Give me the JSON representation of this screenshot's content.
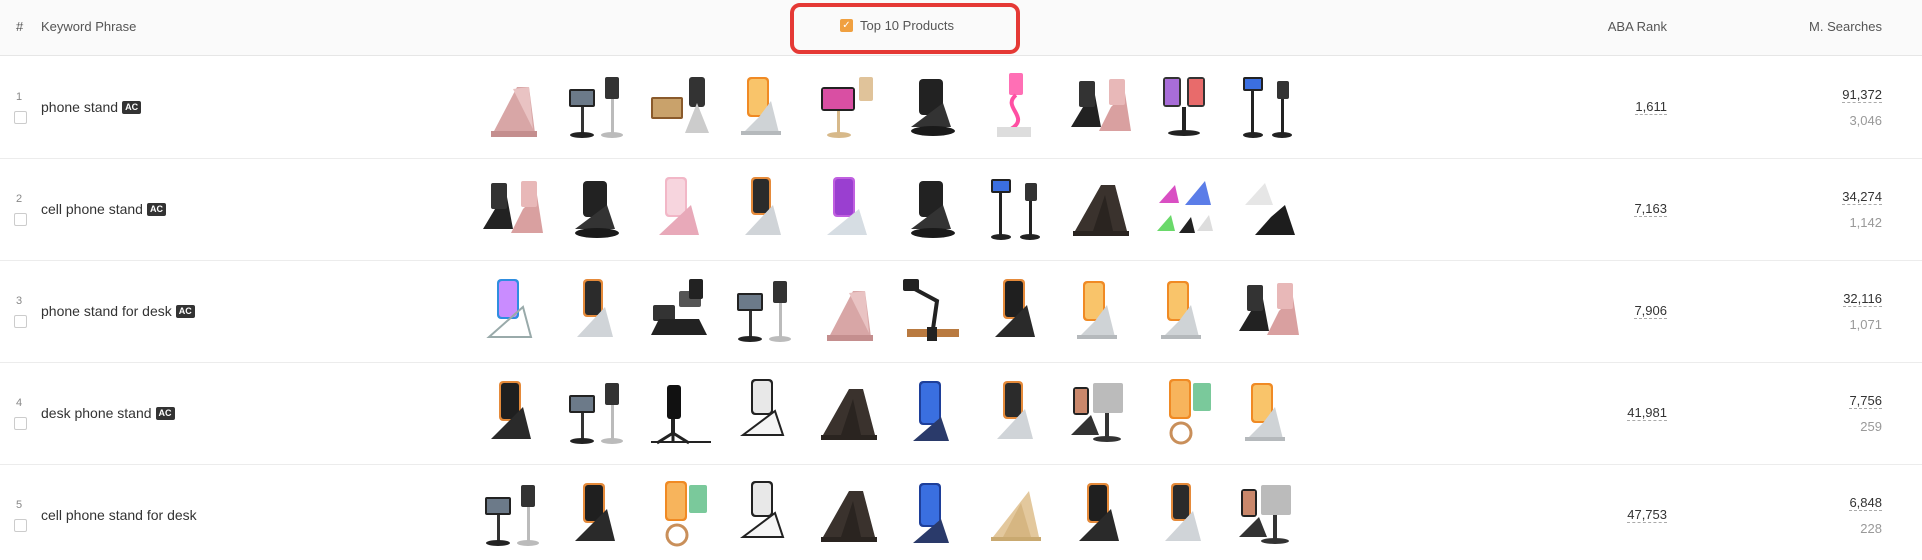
{
  "header": {
    "num": "#",
    "keyword": "Keyword Phrase",
    "top10": "Top 10 Products",
    "aba_rank": "ABA Rank",
    "m_searches": "M. Searches"
  },
  "colors": {
    "highlight_border": "#e53935",
    "checkbox_checked": "#f0a040",
    "badge_bg": "#333333"
  },
  "rows": [
    {
      "num": "1",
      "keyword": "phone stand",
      "badge": "AC",
      "aba_rank": "1,611",
      "monthly": "91,372",
      "secondary": "3,046",
      "products": [
        "rose-gold-stand",
        "tablet-pole-stand",
        "dual-tablet-stand",
        "silver-foldable-stand",
        "tablet-gold-stand",
        "black-foldable-stand",
        "pink-gooseneck-stand",
        "black-rose-stand-pair",
        "dual-phone-stand",
        "black-pole-holder"
      ]
    },
    {
      "num": "2",
      "keyword": "cell phone stand",
      "badge": "AC",
      "aba_rank": "7,163",
      "monthly": "34,274",
      "secondary": "1,142",
      "products": [
        "black-rose-stand-pair",
        "black-foldable-stand",
        "pink-phone-stand",
        "silver-phone-stand",
        "purple-phone-stand",
        "black-foldable-stand",
        "black-pole-holder",
        "dark-brown-stand",
        "multicolor-stands",
        "white-black-stands"
      ]
    },
    {
      "num": "3",
      "keyword": "phone stand for desk",
      "badge": "AC",
      "aba_rank": "7,906",
      "monthly": "32,116",
      "secondary": "1,071",
      "products": [
        "clear-acrylic-stand",
        "silver-phone-stand",
        "black-multi-stand",
        "tablet-pole-stand",
        "rose-gold-stand",
        "arm-clamp-stand",
        "black-phone-stand",
        "silver-foldable-stand",
        "silver-foldable-stand",
        "black-rose-stand-pair"
      ]
    },
    {
      "num": "4",
      "keyword": "desk phone stand",
      "badge": "AC",
      "aba_rank": "41,981",
      "monthly": "7,756",
      "secondary": "259",
      "products": [
        "black-phone-stand",
        "tablet-pole-stand",
        "tripod-stand",
        "white-phone-stand",
        "dark-brown-stand",
        "blue-phone-stand",
        "silver-phone-stand",
        "tablet-silver-stand",
        "rose-ring-stand",
        "silver-foldable-stand"
      ]
    },
    {
      "num": "5",
      "keyword": "cell phone stand for desk",
      "badge": "",
      "aba_rank": "47,753",
      "monthly": "6,848",
      "secondary": "228",
      "products": [
        "tablet-pole-stand",
        "black-phone-stand",
        "rose-ring-stand",
        "white-phone-stand",
        "dark-brown-stand",
        "blue-phone-stand",
        "gold-foldable-stand",
        "black-phone-stand",
        "silver-phone-stand",
        "tablet-silver-stand"
      ]
    }
  ]
}
